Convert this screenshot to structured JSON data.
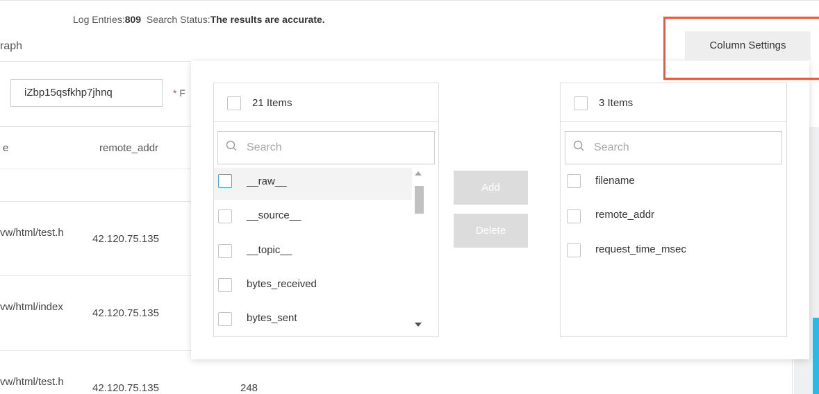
{
  "status_bar": {
    "log_entries_label": "Log Entries:",
    "log_entries_value": "809",
    "search_status_label": "Search Status:",
    "search_status_value": "The results are accurate."
  },
  "tabs": {
    "graph_partial": "raph"
  },
  "column_settings_button": "Column Settings",
  "filter": {
    "input_value": "iZbp15qsfkhp7jhnq",
    "required_star": "*",
    "required_label_partial": "F"
  },
  "table": {
    "headers": [
      "e",
      "remote_addr"
    ],
    "rows": [
      {
        "path": "vw/html/test.h",
        "remote_addr": "42.120.75.135",
        "extra": ""
      },
      {
        "path": "vw/html/index",
        "remote_addr": "42.120.75.135",
        "extra": ""
      },
      {
        "path": "vw/html/test.h",
        "remote_addr": "42.120.75.135",
        "extra": "248"
      }
    ]
  },
  "column_picker": {
    "source": {
      "count_label": "21 Items",
      "search_placeholder": "Search",
      "items": [
        "__raw__",
        "__source__",
        "__topic__",
        "bytes_received",
        "bytes_sent"
      ]
    },
    "add_button": "Add",
    "delete_button": "Delete",
    "target": {
      "count_label": "3 Items",
      "search_placeholder": "Search",
      "items": [
        "filename",
        "remote_addr",
        "request_time_msec"
      ]
    }
  },
  "colors": {
    "highlight": "#e8593d",
    "accent": "#3fa7e3",
    "required": "#e0433b",
    "button_disabled": "#dcdcdc"
  }
}
